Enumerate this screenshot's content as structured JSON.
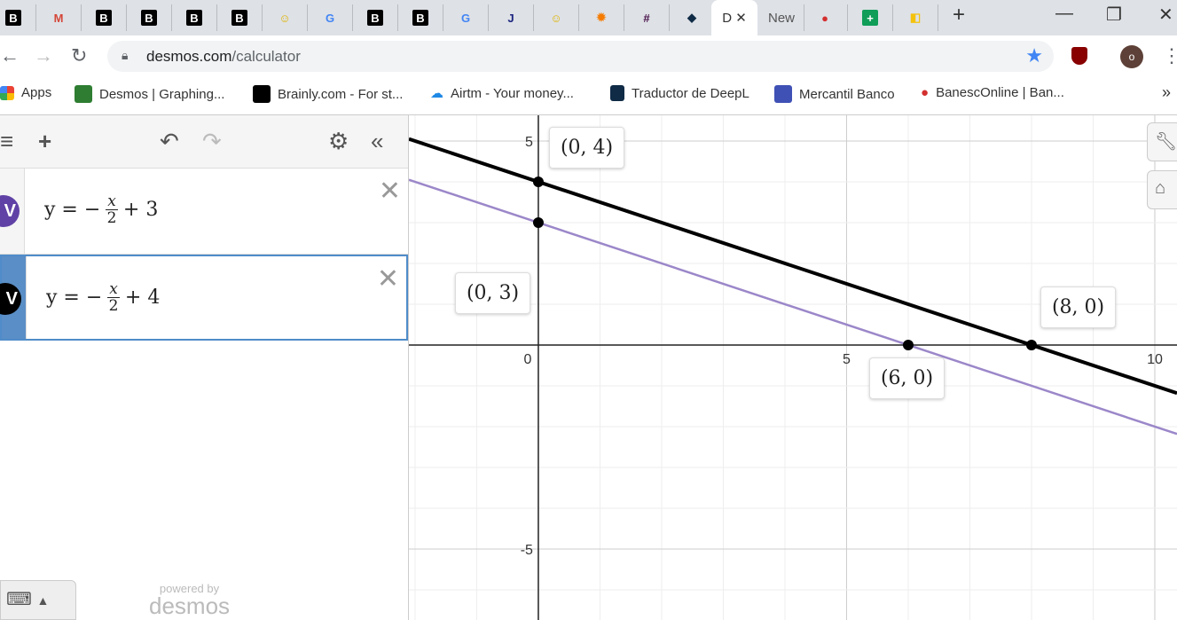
{
  "browser": {
    "tabs": [
      {
        "icon": "B",
        "color": "#000"
      },
      {
        "icon": "M",
        "color": "#d44638"
      },
      {
        "icon": "B",
        "color": "#000"
      },
      {
        "icon": "B",
        "color": "#000"
      },
      {
        "icon": "B",
        "color": "#000"
      },
      {
        "icon": "B",
        "color": "#000"
      },
      {
        "icon": "☺",
        "color": "#e0b400"
      },
      {
        "icon": "G",
        "color": "#4285f4"
      },
      {
        "icon": "B",
        "color": "#000"
      },
      {
        "icon": "B",
        "color": "#000"
      },
      {
        "icon": "G",
        "color": "#4285f4"
      },
      {
        "icon": "J",
        "color": "#1a237e"
      },
      {
        "icon": "☺",
        "color": "#e0b400"
      },
      {
        "icon": "✹",
        "color": "#f57c00"
      },
      {
        "icon": "#",
        "color": "#4a154b"
      },
      {
        "icon": "◆",
        "color": "#0f2b46"
      }
    ],
    "active_tab_title": "D",
    "new_tab_title": "New",
    "url_domain": "desmos.com",
    "url_path": "/calculator",
    "profile_initial": "o",
    "bookmarks": [
      "Apps",
      "Desmos | Graphing...",
      "Brainly.com - For st...",
      "Airtm - Your money...",
      "Traductor de DeepL",
      "Mercantil Banco",
      "BanescOnline | Ban..."
    ],
    "more": "»"
  },
  "calculator": {
    "expressions": [
      {
        "lhs": "y = −",
        "num": "x",
        "den": "2",
        "rhs": "+ 3",
        "color": "#6042a6"
      },
      {
        "lhs": "y = −",
        "num": "x",
        "den": "2",
        "rhs": "+ 4",
        "color": "#000000"
      }
    ],
    "powered_by": "powered by",
    "brand": "desmos"
  },
  "graph": {
    "xrange": [
      -2.1,
      10.36
    ],
    "yrange": [
      -6.74,
      5.63
    ],
    "x_ticks": [
      "0",
      "5",
      "10"
    ],
    "y_ticks": [
      "5",
      "-5"
    ],
    "lines": [
      {
        "slope": -0.5,
        "intercept": 3,
        "color": "#9b87c9"
      },
      {
        "slope": -0.5,
        "intercept": 4,
        "color": "#000000"
      }
    ],
    "points": [
      {
        "x": 0,
        "y": 4,
        "label": "(0, 4)"
      },
      {
        "x": 0,
        "y": 3,
        "label": "(0, 3)"
      },
      {
        "x": 8,
        "y": 0,
        "label": "(8, 0)"
      },
      {
        "x": 6,
        "y": 0,
        "label": "(6, 0)"
      }
    ]
  }
}
